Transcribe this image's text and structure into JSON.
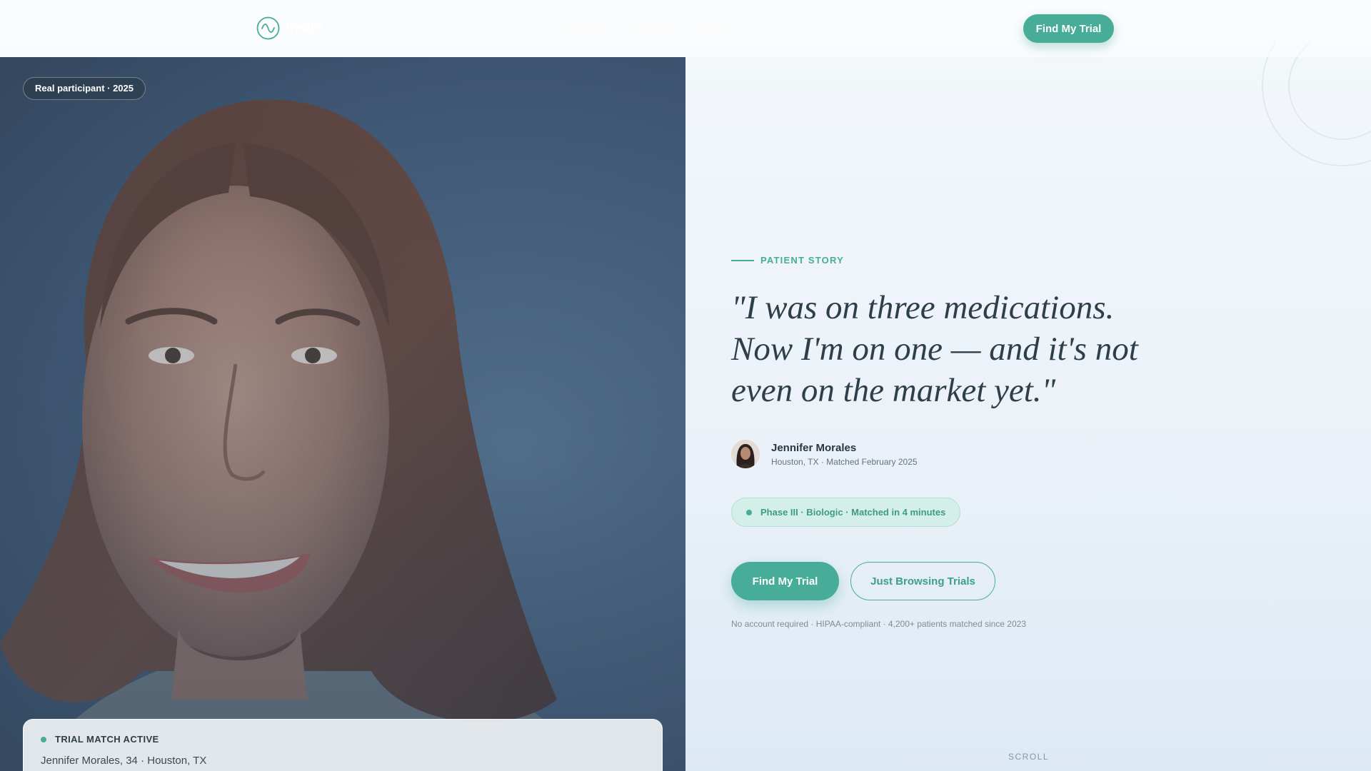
{
  "header": {
    "logo_text": "Ireate",
    "logo_icon": "wave-circle-icon",
    "nav": [
      "Find trials",
      "Our story",
      "Sign in"
    ],
    "cta_label": "Find My Trial"
  },
  "photo": {
    "badge": "Real participant · 2025",
    "match_card": {
      "status": "TRIAL MATCH ACTIVE",
      "person": "Jennifer Morales, 34 · Houston, TX"
    }
  },
  "story": {
    "eyebrow": "PATIENT STORY",
    "quote": "\"I was on three medications. Now I'm on one — and it's not even on the market yet.\"",
    "author_name": "Jennifer Morales",
    "author_meta": "Houston, TX · Matched February 2025",
    "phase_pill": "Phase III · Biologic · Matched in 4 minutes",
    "primary_cta": "Find My Trial",
    "secondary_cta": "Just Browsing Trials",
    "trust_line": "No account required · HIPAA-compliant · 4,200+ patients matched since 2023",
    "scroll_label": "SCROLL"
  },
  "colors": {
    "accent": "#47ad98",
    "accent_light": "#d4efe7",
    "photo_bg": "#4a6685"
  }
}
